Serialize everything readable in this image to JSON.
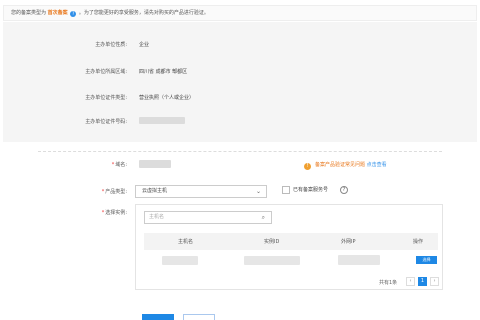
{
  "notice": {
    "prefix": "您的备案类型为",
    "type": "首次备案",
    "help_icon": "question-icon",
    "suffix": "。为了您能更好的享受服务，请先对购买的产品进行验证。"
  },
  "info": {
    "nature_label": "主办单位性质",
    "nature_value": "企业",
    "region_label": "主办单位所属区域",
    "region_value": "四川省 成都市 郫都区",
    "cert_type_label": "主办单位证件类型",
    "cert_type_value": "营业执照（个人或企业）",
    "cert_no_label": "主办单位证件号码"
  },
  "form": {
    "domain_label": "域名",
    "product_type_label": "产品类型",
    "product_type_value": "云虚拟主机",
    "has_service_no_label": "已有备案服务号",
    "select_instance_label": "选择实例",
    "search_placeholder": "主机名",
    "warning_text": "备案产品验证常见问题",
    "warning_link": "点击查看"
  },
  "table": {
    "headers": [
      "主机名",
      "实例ID",
      "外网IP",
      "操作"
    ],
    "select_btn": "选择",
    "pager_total": "共有1条",
    "pager_page": "1",
    "prev": "‹",
    "next": "›"
  },
  "colors": {
    "accent": "#1e88e5",
    "warning": "#e8761a",
    "link": "#2f8fe8"
  }
}
